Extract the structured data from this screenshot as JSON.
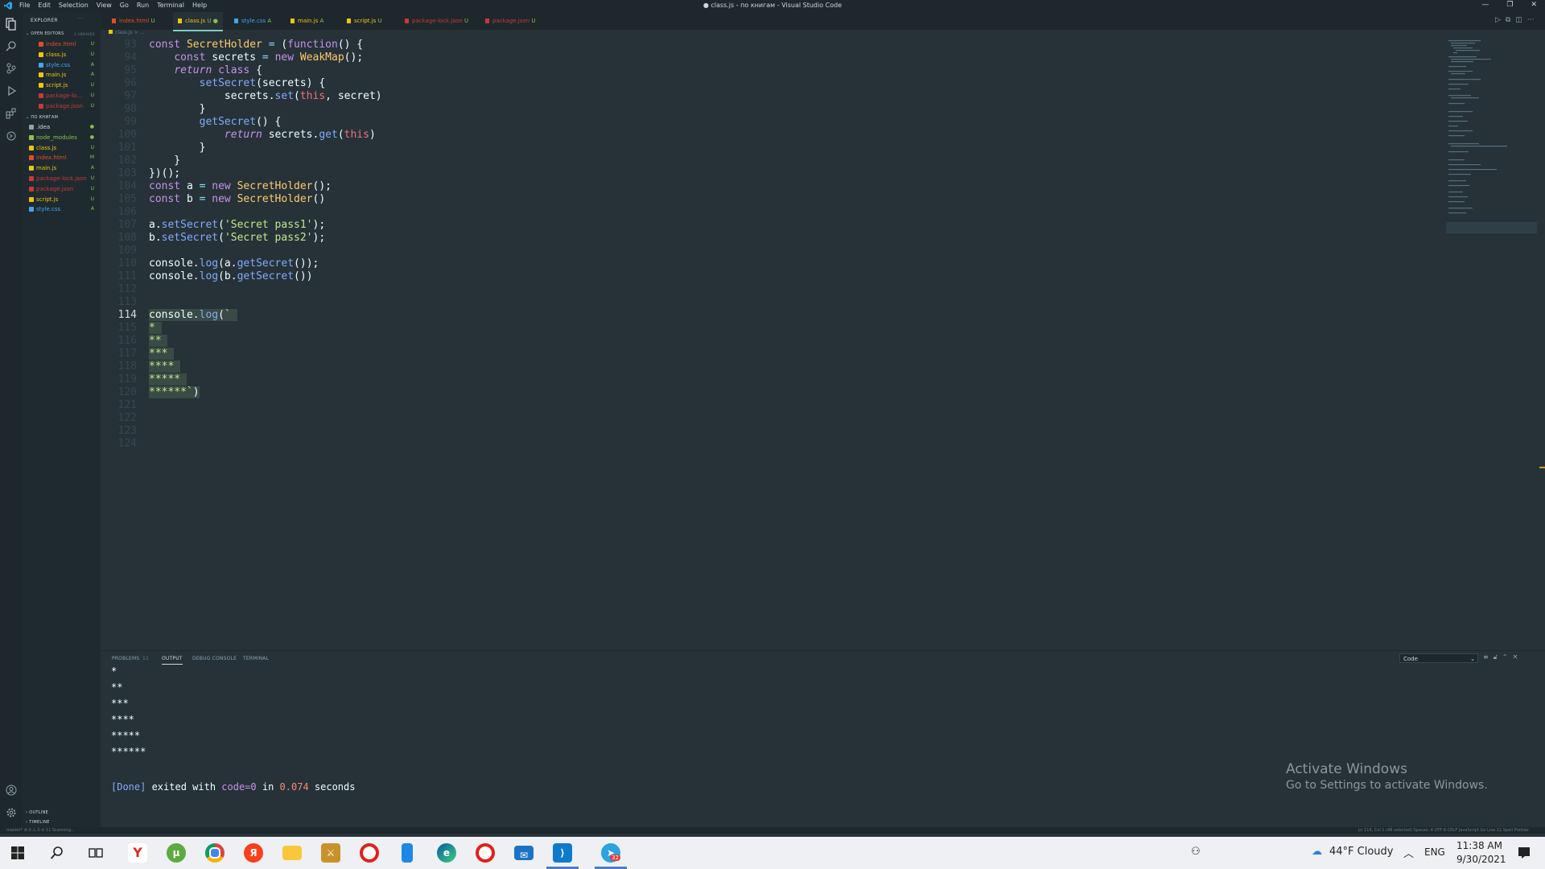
{
  "app": {
    "title": "● class.js - по книгам - Visual Studio Code",
    "menu": [
      "File",
      "Edit",
      "Selection",
      "View",
      "Go",
      "Run",
      "Terminal",
      "Help"
    ],
    "window_controls": [
      "—",
      "❐",
      "✕"
    ]
  },
  "sidebar": {
    "explorer_label": "EXPLORER",
    "open_editors_label": "OPEN EDITORS",
    "open_editors_badge": "1 UNSAVED",
    "open_editors": [
      {
        "name": "index.html",
        "badge": "U",
        "color": "#e44d26"
      },
      {
        "name": "class.js",
        "badge": "U",
        "color": "#f1c40f"
      },
      {
        "name": "style.css",
        "badge": "A",
        "color": "#42a5f5"
      },
      {
        "name": "main.js",
        "badge": "A",
        "color": "#f1c40f"
      },
      {
        "name": "script.js",
        "badge": "U",
        "color": "#f1c40f"
      },
      {
        "name": "package-lo...",
        "badge": "U",
        "color": "#cb3837"
      },
      {
        "name": "package.json",
        "badge": "U",
        "color": "#cb3837"
      }
    ],
    "project_label": "ПО КНИГАМ",
    "files": [
      {
        "name": ".idea",
        "badge": "●",
        "color": "#90a4ae"
      },
      {
        "name": "node_modules",
        "badge": "●",
        "color": "#8bc34a"
      },
      {
        "name": "class.js",
        "badge": "U",
        "color": "#f1c40f"
      },
      {
        "name": "index.html",
        "badge": "M",
        "color": "#e44d26"
      },
      {
        "name": "main.js",
        "badge": "A",
        "color": "#f1c40f"
      },
      {
        "name": "package-lock.json",
        "badge": "U",
        "color": "#cb3837"
      },
      {
        "name": "package.json",
        "badge": "U",
        "color": "#cb3837"
      },
      {
        "name": "script.js",
        "badge": "U",
        "color": "#f1c40f"
      },
      {
        "name": "style.css",
        "badge": "A",
        "color": "#42a5f5"
      }
    ],
    "outline_label": "OUTLINE",
    "timeline_label": "TIMELINE"
  },
  "tabs": [
    {
      "name": "index.html",
      "badge": "U",
      "color": "#e44d26"
    },
    {
      "name": "class.js",
      "badge": "U ●",
      "color": "#f1c40f"
    },
    {
      "name": "style.css",
      "badge": "A",
      "color": "#42a5f5"
    },
    {
      "name": "main.js",
      "badge": "A",
      "color": "#f1c40f"
    },
    {
      "name": "script.js",
      "badge": "U",
      "color": "#f1c40f"
    },
    {
      "name": "package-lock.json",
      "badge": "U",
      "color": "#cb3837"
    },
    {
      "name": "package.json",
      "badge": "U",
      "color": "#cb3837"
    }
  ],
  "breadcrumb": "class.js > ...",
  "editor": {
    "line_numbers": [
      "93",
      "94",
      "95",
      "96",
      "97",
      "98",
      "99",
      "100",
      "101",
      "102",
      "103",
      "104",
      "105",
      "106",
      "107",
      "108",
      "109",
      "110",
      "111",
      "112",
      "113",
      "114",
      "115",
      "116",
      "117",
      "118",
      "119",
      "120",
      "121",
      "122",
      "123",
      "124"
    ],
    "current_line": "114"
  },
  "panel": {
    "tabs": [
      "PROBLEMS",
      "OUTPUT",
      "DEBUG CONSOLE",
      "TERMINAL"
    ],
    "problems_count": "11",
    "select_value": "Code",
    "output_lines": [
      "*",
      "**",
      "***",
      "****",
      "*****",
      "******"
    ],
    "done": {
      "tag": "[Done]",
      "text1": " exited with ",
      "code": "code=0",
      "text2": " in ",
      "time": "0.074",
      "text3": " seconds"
    }
  },
  "watermark": {
    "title": "Activate Windows",
    "subtitle": "Go to Settings to activate Windows."
  },
  "statusbar": {
    "left": "master*   ⊗ 0 ⚠ 0   ⊘ 11   Scanning...",
    "right": "Ln 114, Col 1 (48 selected)   Spaces: 4   UTF-8   CRLF   JavaScript   Go Live   11 Spell   Prettier"
  },
  "taskbar": {
    "weather": "44°F  Cloudy",
    "lang": "ENG",
    "time": "11:38 AM",
    "date": "9/30/2021",
    "telegram_badge": "32"
  }
}
